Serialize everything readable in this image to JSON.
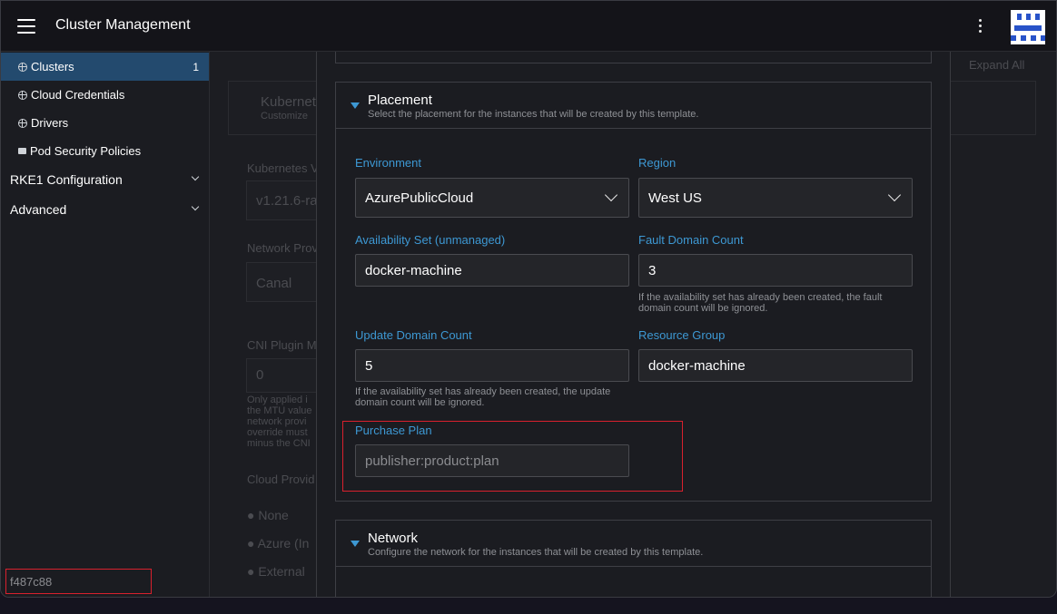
{
  "header": {
    "title": "Cluster Management"
  },
  "sidebar": {
    "items": [
      {
        "label": "Clusters",
        "count": "1"
      },
      {
        "label": "Cloud Credentials"
      },
      {
        "label": "Drivers"
      },
      {
        "label": "Pod Security Policies"
      }
    ],
    "groups": [
      {
        "label": "RKE1 Configuration"
      },
      {
        "label": "Advanced"
      }
    ],
    "commit": "f487c88"
  },
  "background": {
    "expand_all": "Expand All",
    "kubernetes_title": "Kubernetes",
    "kubernetes_sub": "Customize",
    "kubernetes_version_label": "Kubernetes V",
    "kubernetes_version_value": "v1.21.6-ra",
    "network_provider_label": "Network Prov",
    "network_provider_value": "Canal",
    "cni_label": "CNI Plugin M",
    "cni_value": "0",
    "cni_help_1": "Only applied i",
    "cni_help_2": "the MTU value",
    "cni_help_3": "network provi",
    "cni_help_4": "override must",
    "cni_help_5": "minus the CNI",
    "cloud_provider_label": "Cloud Provid",
    "radio_none": "None",
    "radio_azure": "Azure (In",
    "radio_external": "External"
  },
  "placement": {
    "title": "Placement",
    "subtitle": "Select the placement for the instances that will be created by this template.",
    "environment": {
      "label": "Environment",
      "value": "AzurePublicCloud"
    },
    "region": {
      "label": "Region",
      "value": "West US"
    },
    "availability_set": {
      "label": "Availability Set (unmanaged)",
      "value": "docker-machine"
    },
    "fault_domain": {
      "label": "Fault Domain Count",
      "value": "3",
      "help": "If the availability set has already been created, the fault domain count will be ignored."
    },
    "update_domain": {
      "label": "Update Domain Count",
      "value": "5",
      "help": "If the availability set has already been created, the update domain count will be ignored."
    },
    "resource_group": {
      "label": "Resource Group",
      "value": "docker-machine"
    },
    "purchase_plan": {
      "label": "Purchase Plan",
      "placeholder": "publisher:product:plan"
    }
  },
  "network": {
    "title": "Network",
    "subtitle": "Configure the network for the instances that will be created by this template."
  },
  "colors": {
    "accent": "#3d98d3",
    "highlight": "#d9202d",
    "active_nav": "#234a6e"
  }
}
